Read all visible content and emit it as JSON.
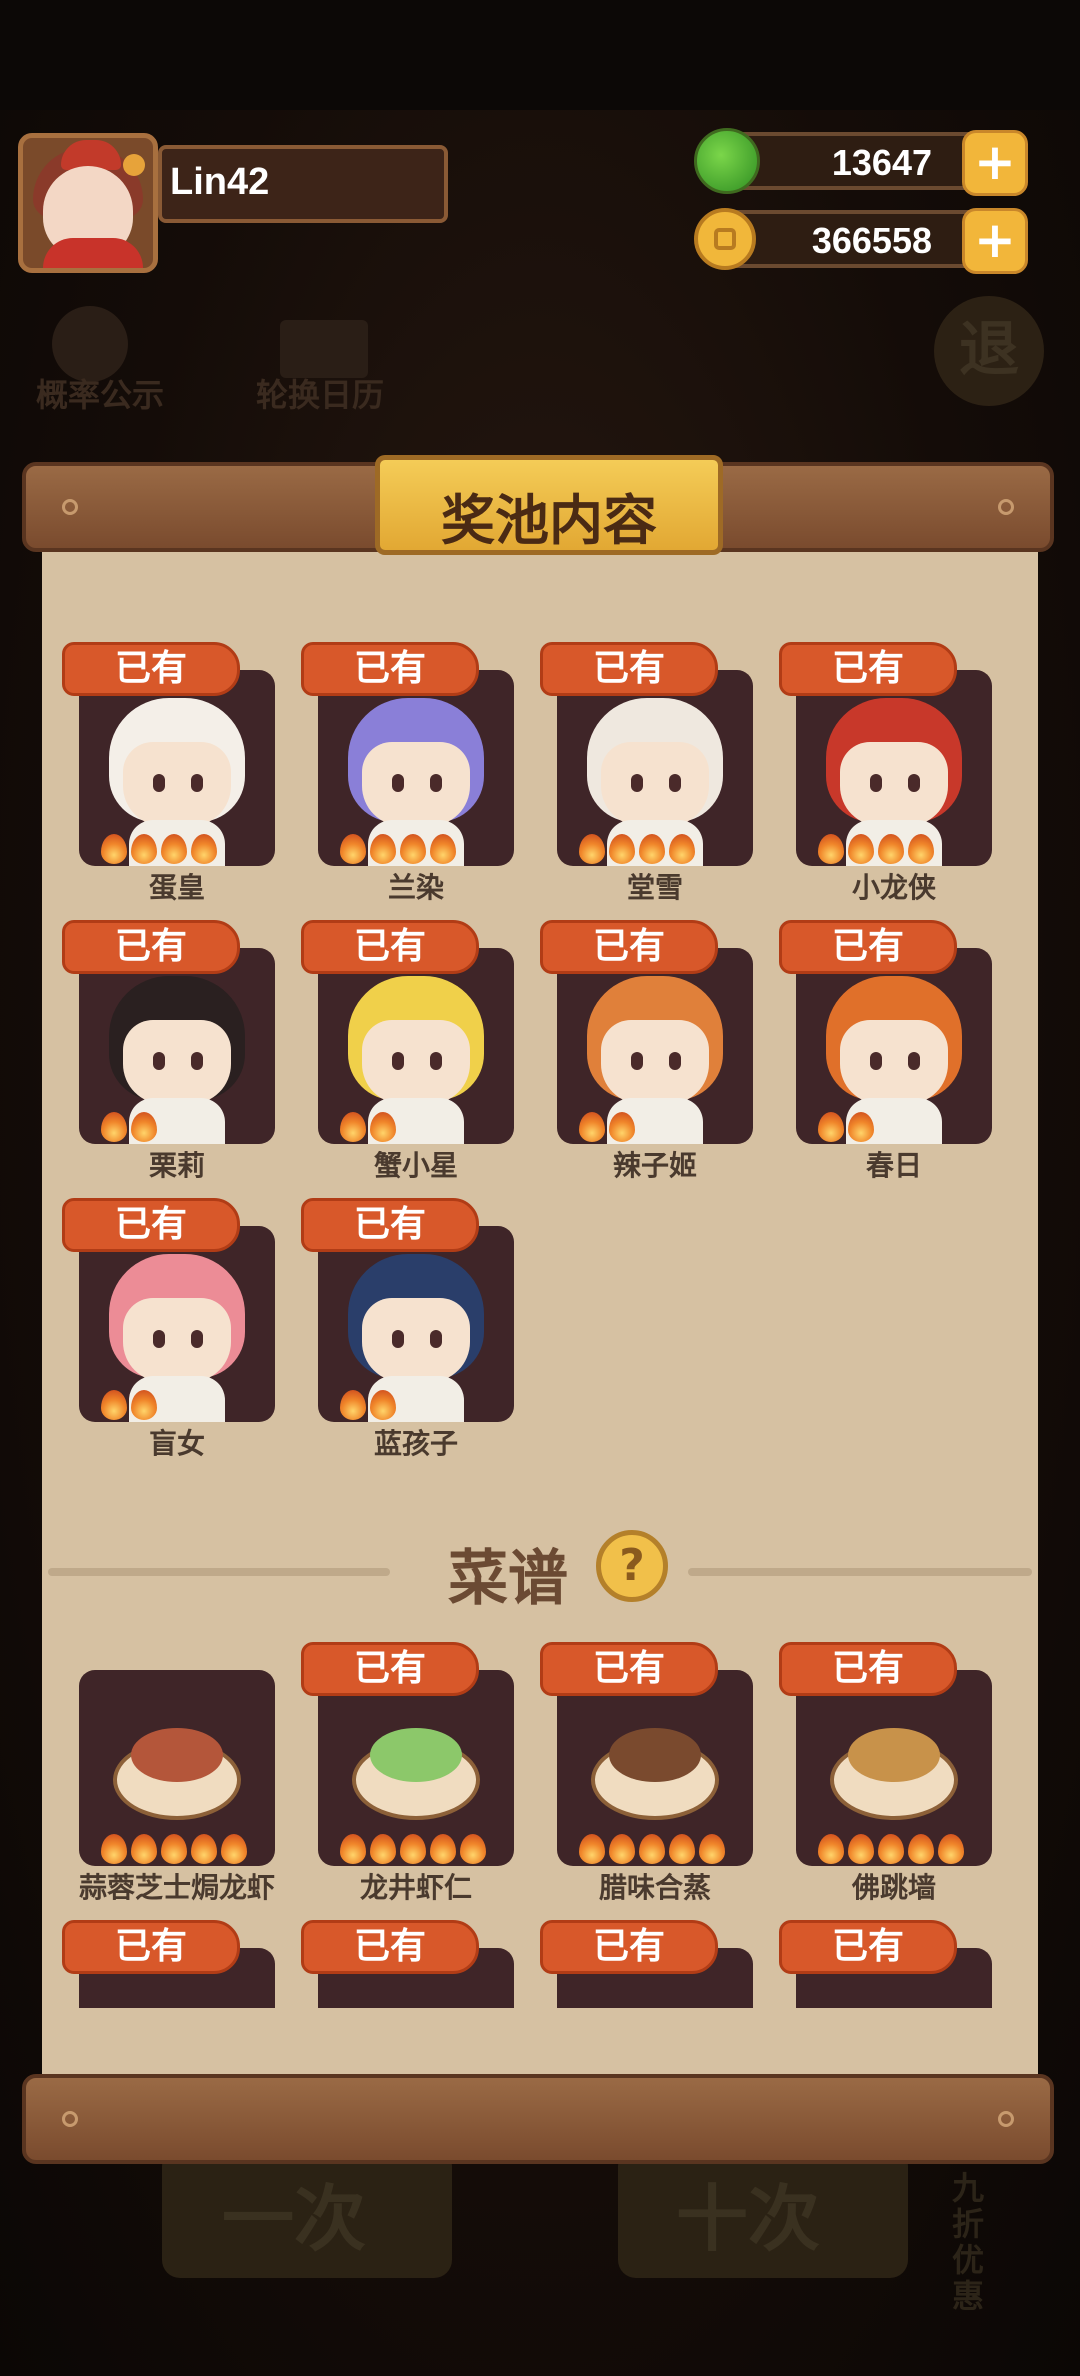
{
  "player": {
    "name": "Lin42"
  },
  "currencies": [
    {
      "name": "jade",
      "icon": "green-apple-icon",
      "value": "13647"
    },
    {
      "name": "coins",
      "icon": "gold-coin-icon",
      "value": "366558"
    }
  ],
  "background": {
    "probability_label": "概率公示",
    "calendar_label": "轮换日历",
    "exit_label": "退",
    "single_draw_label": "一次",
    "ten_draw_label": "十次",
    "discount_label": "九折优惠"
  },
  "panel": {
    "title": "奖池内容",
    "owned_label": "已有",
    "characters": [
      {
        "name": "蛋皇",
        "owned": true,
        "stars": 4,
        "hair": "#f4efe8"
      },
      {
        "name": "兰染",
        "owned": true,
        "stars": 4,
        "hair": "#8a7fd8"
      },
      {
        "name": "堂雪",
        "owned": true,
        "stars": 4,
        "hair": "#efe8df"
      },
      {
        "name": "小龙侠",
        "owned": true,
        "stars": 4,
        "hair": "#c8382a"
      },
      {
        "name": "栗莉",
        "owned": true,
        "stars": 2,
        "hair": "#2a2020"
      },
      {
        "name": "蟹小星",
        "owned": true,
        "stars": 2,
        "hair": "#f0d04a"
      },
      {
        "name": "辣子姬",
        "owned": true,
        "stars": 2,
        "hair": "#e0803a"
      },
      {
        "name": "春日",
        "owned": true,
        "stars": 2,
        "hair": "#e0702a"
      },
      {
        "name": "盲女",
        "owned": true,
        "stars": 2,
        "hair": "#ec8c96"
      },
      {
        "name": "蓝孩子",
        "owned": true,
        "stars": 2,
        "hair": "#2a3e6a"
      }
    ],
    "recipe_title": "菜谱",
    "recipes": [
      {
        "name": "蒜蓉芝士焗龙虾",
        "owned": false,
        "stars": 5,
        "food": "#b4563a"
      },
      {
        "name": "龙井虾仁",
        "owned": true,
        "stars": 5,
        "food": "#8cc86a"
      },
      {
        "name": "腊味合蒸",
        "owned": true,
        "stars": 5,
        "food": "#7a4a2e"
      },
      {
        "name": "佛跳墙",
        "owned": true,
        "stars": 5,
        "food": "#c8924a"
      }
    ],
    "recipes_row2_owned": [
      "已有",
      "已有",
      "已有",
      "已有"
    ]
  }
}
